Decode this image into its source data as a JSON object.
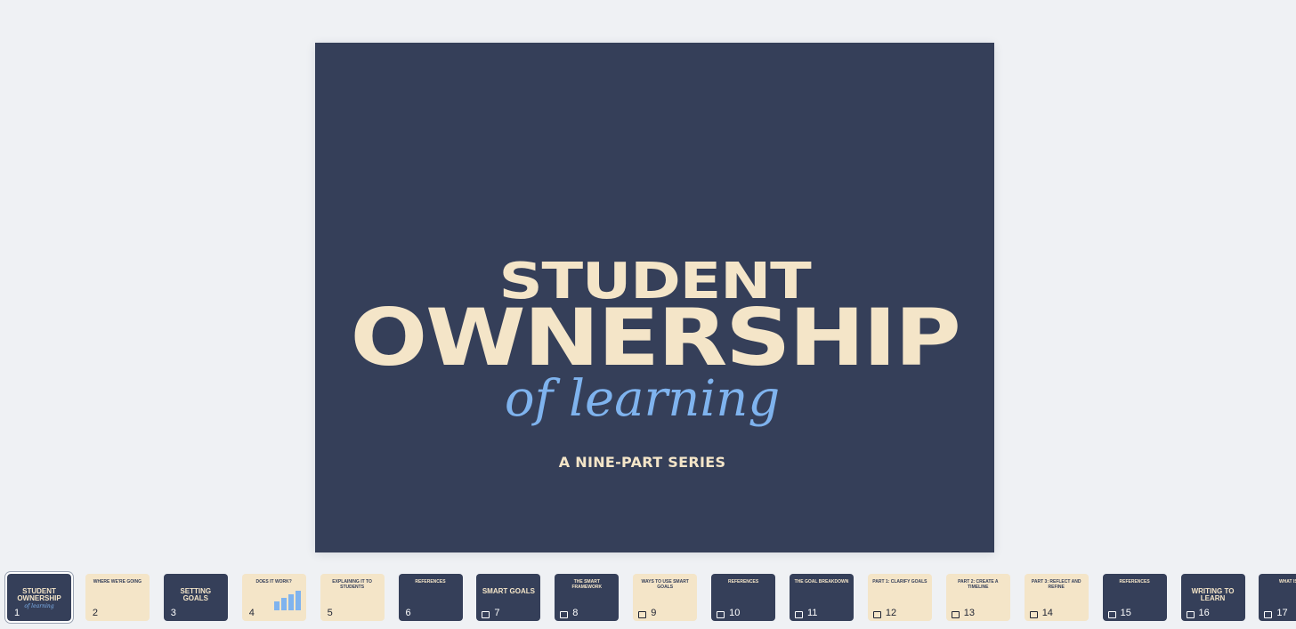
{
  "slide": {
    "title_line1": "STUDENT",
    "title_line2": "OWNERSHIP",
    "title_line3": "of learning",
    "subtitle": "A NINE-PART SERIES",
    "colors": {
      "background": "#353f59",
      "cream": "#f4e5c8",
      "blue": "#7fb3ee"
    }
  },
  "thumbnails": [
    {
      "num": "1",
      "theme": "dark",
      "selected": true,
      "anim": false,
      "text": "STUDENT OWNERSHIP",
      "sub": "of learning"
    },
    {
      "num": "2",
      "theme": "cream",
      "anim": false,
      "text": "WHERE WE'RE GOING"
    },
    {
      "num": "3",
      "theme": "dark",
      "anim": false,
      "text": "SETTING GOALS"
    },
    {
      "num": "4",
      "theme": "cream",
      "anim": false,
      "text": "DOES IT WORK?"
    },
    {
      "num": "5",
      "theme": "cream",
      "anim": false,
      "text": "EXPLAINING IT TO STUDENTS"
    },
    {
      "num": "6",
      "theme": "dark",
      "anim": false,
      "text": "REFERENCES"
    },
    {
      "num": "7",
      "theme": "dark",
      "anim": true,
      "text": "SMART GOALS"
    },
    {
      "num": "8",
      "theme": "dark",
      "anim": true,
      "text": "THE SMART FRAMEWORK"
    },
    {
      "num": "9",
      "theme": "cream",
      "anim": true,
      "text": "WAYS TO USE SMART GOALS"
    },
    {
      "num": "10",
      "theme": "dark",
      "anim": true,
      "text": "REFERENCES"
    },
    {
      "num": "11",
      "theme": "dark",
      "anim": true,
      "text": "THE GOAL BREAKDOWN"
    },
    {
      "num": "12",
      "theme": "cream",
      "anim": true,
      "text": "PART 1: CLARIFY GOALS"
    },
    {
      "num": "13",
      "theme": "cream",
      "anim": true,
      "text": "PART 2: CREATE A TIMELINE"
    },
    {
      "num": "14",
      "theme": "cream",
      "anim": true,
      "text": "PART 3: REFLECT AND REFINE"
    },
    {
      "num": "15",
      "theme": "dark",
      "anim": true,
      "text": "REFERENCES"
    },
    {
      "num": "16",
      "theme": "dark",
      "anim": true,
      "text": "WRITING TO LEARN"
    },
    {
      "num": "17",
      "theme": "dark",
      "anim": true,
      "text": "WHAT IS W"
    }
  ]
}
